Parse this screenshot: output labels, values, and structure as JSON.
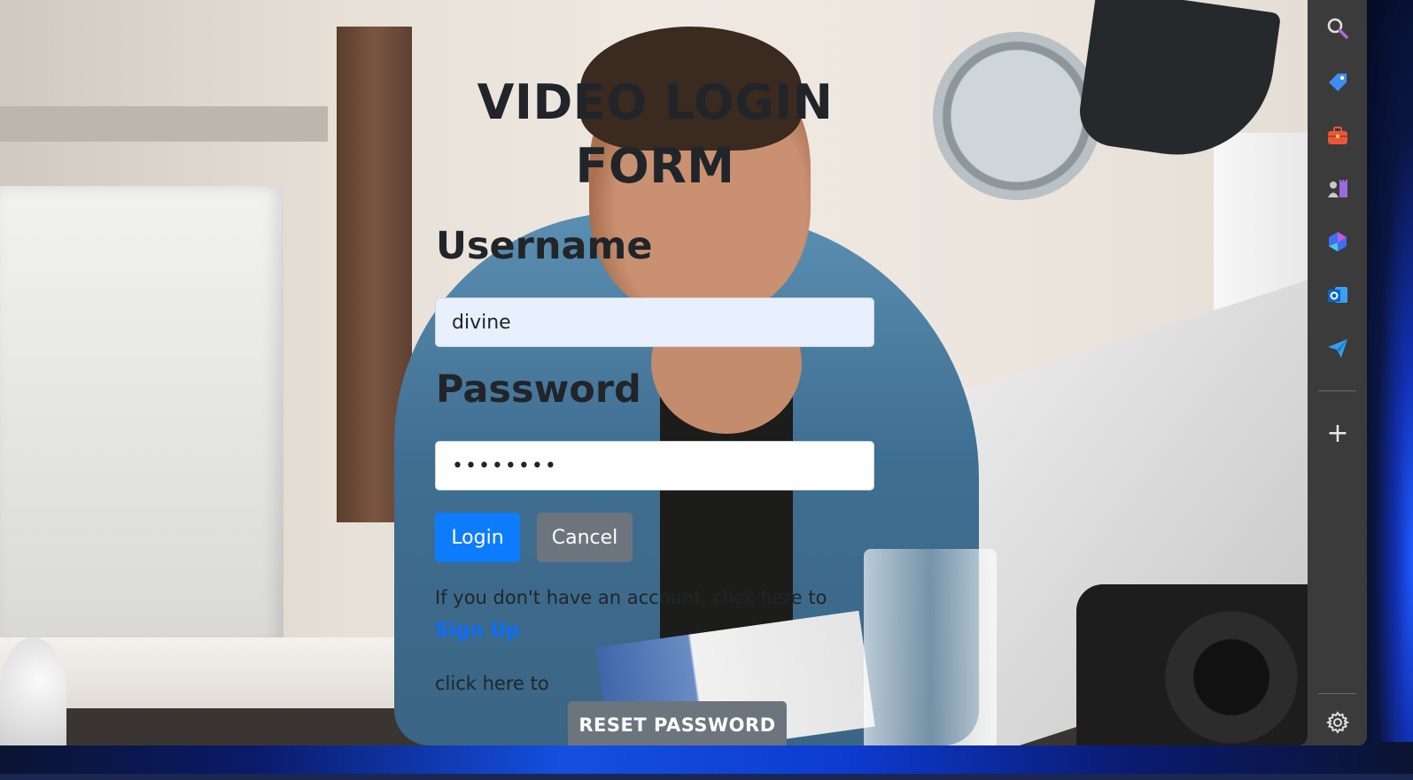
{
  "form": {
    "title": "VIDEO LOGIN FORM",
    "username_label": "Username",
    "username_value": "divine",
    "password_label": "Password",
    "password_value": "dividivi",
    "login_label": "Login",
    "cancel_label": "Cancel",
    "signup_hint": "If you don't have an account, click here to",
    "signup_link": "Sign Up",
    "reset_hint": "click here to",
    "reset_label": "RESET PASSWORD"
  },
  "sidebar": {
    "items": [
      {
        "icon": "search-icon"
      },
      {
        "icon": "tag-icon"
      },
      {
        "icon": "toolbox-icon"
      },
      {
        "icon": "games-icon"
      },
      {
        "icon": "copilot-icon"
      },
      {
        "icon": "outlook-icon"
      },
      {
        "icon": "send-icon"
      }
    ],
    "add_icon": "plus-icon",
    "settings_icon": "gear-icon"
  },
  "colors": {
    "primary": "#0d7cff",
    "secondary": "#6c757d",
    "link": "#0d6efd",
    "sidebar_bg": "#3b3b3b"
  }
}
